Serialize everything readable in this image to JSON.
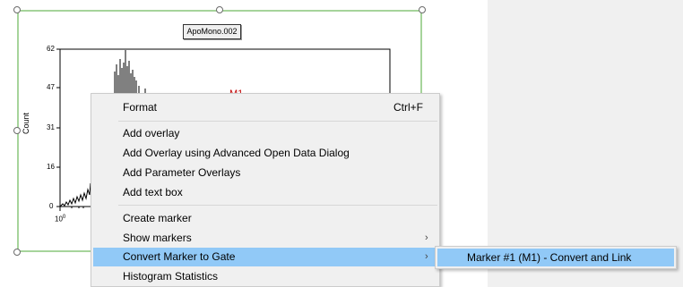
{
  "plot": {
    "title": "ApoMono.002",
    "y_axis_label": "Count",
    "y_ticks": [
      "62",
      "47",
      "31",
      "16",
      "0"
    ],
    "x_tick": "10",
    "x_tick_exp": "0",
    "marker_label": "M1"
  },
  "colors": {
    "selection": "#a6d49b",
    "menu_highlight": "#91c9f7",
    "marker": "#c00000"
  },
  "context_menu": {
    "format": "Format",
    "format_shortcut": "Ctrl+F",
    "add_overlay": "Add overlay",
    "add_overlay_advanced": "Add Overlay using Advanced Open Data Dialog",
    "add_parameter_overlays": "Add Parameter Overlays",
    "add_text_box": "Add text box",
    "create_marker": "Create marker",
    "show_markers": "Show markers",
    "convert_marker_to_gate": "Convert Marker to Gate",
    "histogram_statistics": "Histogram Statistics"
  },
  "submenu": {
    "marker_convert": "Marker #1 (M1) - Convert and Link"
  }
}
